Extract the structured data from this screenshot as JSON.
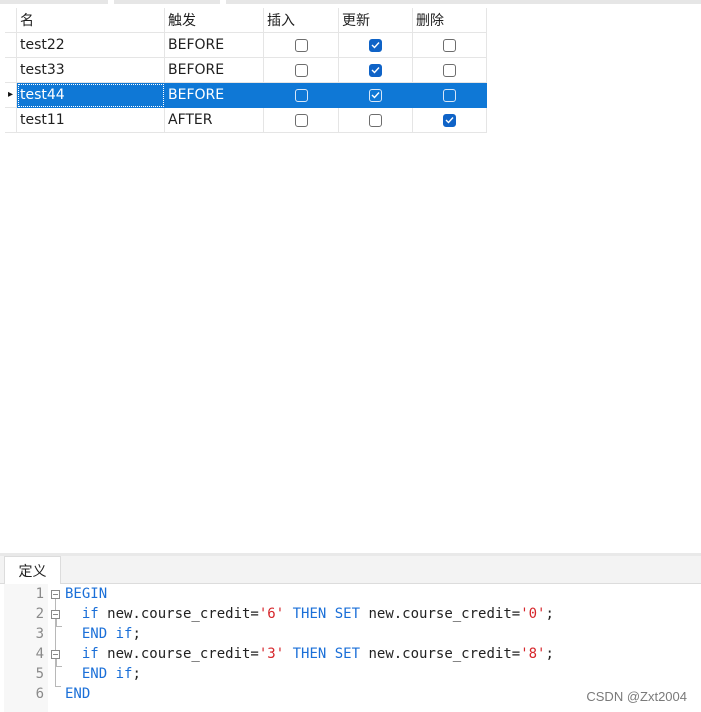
{
  "grid": {
    "headers": {
      "name": "名",
      "trigger": "触发",
      "insert": "插入",
      "update": "更新",
      "delete": "删除"
    },
    "rows": [
      {
        "name": "test22",
        "trigger": "BEFORE",
        "insert": false,
        "update": true,
        "delete": false
      },
      {
        "name": "test33",
        "trigger": "BEFORE",
        "insert": false,
        "update": true,
        "delete": false
      },
      {
        "name": "test44",
        "trigger": "BEFORE",
        "insert": false,
        "update": true,
        "delete": false,
        "selected": true
      },
      {
        "name": "test11",
        "trigger": "AFTER",
        "insert": false,
        "update": false,
        "delete": true
      }
    ]
  },
  "panel": {
    "tab_label": "定义"
  },
  "editor": {
    "line_numbers": [
      "1",
      "2",
      "3",
      "4",
      "5",
      "6"
    ],
    "code": {
      "l1_kw": "BEGIN",
      "l2_if": "if",
      "l2_a": " new.course_credit=",
      "l2_s1": "'6'",
      "l2_then": " THEN SET",
      "l2_b": " new.course_credit=",
      "l2_s2": "'0'",
      "l2_end": ";",
      "l3_kw": "END if",
      "l3_end": ";",
      "l4_if": "if",
      "l4_a": " new.course_credit=",
      "l4_s1": "'3'",
      "l4_then": " THEN SET",
      "l4_b": " new.course_credit=",
      "l4_s2": "'8'",
      "l4_end": ";",
      "l5_kw": "END if",
      "l5_end": ";",
      "l6_kw": "END"
    }
  },
  "watermark": "CSDN @Zxt2004",
  "colors": {
    "selection": "#0f78d6",
    "keyword": "#1a6fd8",
    "string": "#d6262b",
    "checkbox_on": "#0f63c7"
  }
}
